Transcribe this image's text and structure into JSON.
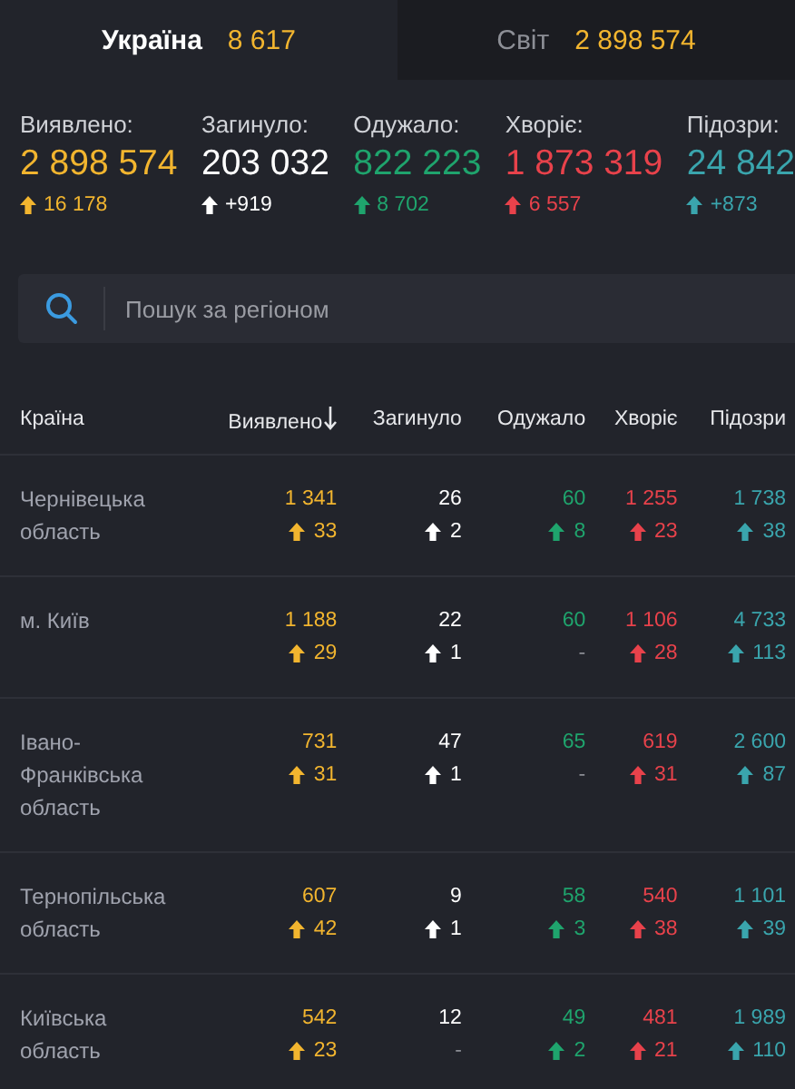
{
  "tabs": [
    {
      "label": "Україна",
      "count": "8 617",
      "selected": true
    },
    {
      "label": "Світ",
      "count": "2 898 574",
      "selected": false
    }
  ],
  "summary": [
    {
      "kind": "confirmed",
      "label": "Виявлено:",
      "value": "2 898 574",
      "delta": "16 178"
    },
    {
      "kind": "deaths",
      "label": "Загинуло:",
      "value": "203 032",
      "delta": "+919"
    },
    {
      "kind": "recovered",
      "label": "Одужало:",
      "value": "822 223",
      "delta": "8 702"
    },
    {
      "kind": "sick",
      "label": "Хворіє:",
      "value": "1 873 319",
      "delta": "6 557"
    },
    {
      "kind": "suspected",
      "label": "Підозри:",
      "value": "24 842",
      "delta": "+873"
    }
  ],
  "search": {
    "placeholder": "Пошук за регіоном"
  },
  "table": {
    "columns": [
      {
        "label": "Країна",
        "kind": "name",
        "sorted": false
      },
      {
        "label": "Виявлено",
        "kind": "confirmed",
        "sorted": true
      },
      {
        "label": "Загинуло",
        "kind": "deaths",
        "sorted": false
      },
      {
        "label": "Одужало",
        "kind": "recovered",
        "sorted": false
      },
      {
        "label": "Хворіє",
        "kind": "sick",
        "sorted": false
      },
      {
        "label": "Підозри",
        "kind": "suspected",
        "sorted": false
      }
    ],
    "rows": [
      {
        "cells": [
          {
            "value": "Чернівецька область"
          },
          {
            "value": "1 341",
            "delta": "33"
          },
          {
            "value": "26",
            "delta": "2"
          },
          {
            "value": "60",
            "delta": "8"
          },
          {
            "value": "1 255",
            "delta": "23"
          },
          {
            "value": "1 738",
            "delta": "38"
          }
        ]
      },
      {
        "cells": [
          {
            "value": "м. Київ"
          },
          {
            "value": "1 188",
            "delta": "29"
          },
          {
            "value": "22",
            "delta": "1"
          },
          {
            "value": "60",
            "delta": "-"
          },
          {
            "value": "1 106",
            "delta": "28"
          },
          {
            "value": "4 733",
            "delta": "113"
          }
        ]
      },
      {
        "cells": [
          {
            "value": "Івано-Франківська область"
          },
          {
            "value": "731",
            "delta": "31"
          },
          {
            "value": "47",
            "delta": "1"
          },
          {
            "value": "65",
            "delta": "-"
          },
          {
            "value": "619",
            "delta": "31"
          },
          {
            "value": "2 600",
            "delta": "87"
          }
        ]
      },
      {
        "cells": [
          {
            "value": "Тернопільська область"
          },
          {
            "value": "607",
            "delta": "42"
          },
          {
            "value": "9",
            "delta": "1"
          },
          {
            "value": "58",
            "delta": "3"
          },
          {
            "value": "540",
            "delta": "38"
          },
          {
            "value": "1 101",
            "delta": "39"
          }
        ]
      },
      {
        "cells": [
          {
            "value": "Київська область"
          },
          {
            "value": "542",
            "delta": "23"
          },
          {
            "value": "12",
            "delta": "-"
          },
          {
            "value": "49",
            "delta": "2"
          },
          {
            "value": "481",
            "delta": "21"
          },
          {
            "value": "1 989",
            "delta": "110"
          }
        ]
      }
    ]
  }
}
